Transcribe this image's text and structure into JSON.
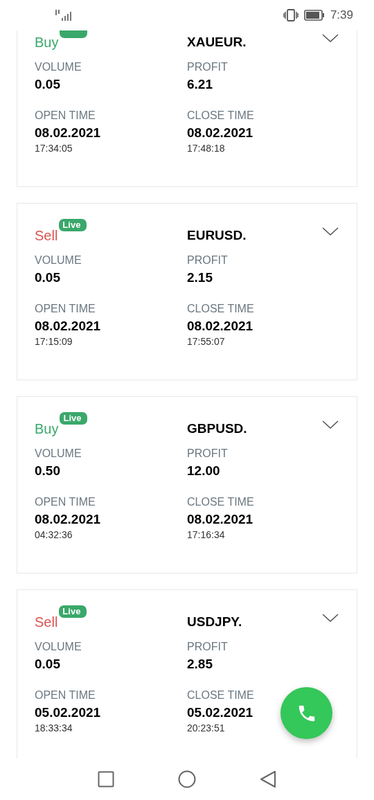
{
  "status_bar": {
    "time": "7:39"
  },
  "trades": [
    {
      "side": "Buy",
      "kind": "buy",
      "live": true,
      "symbol": "XAUEUR.",
      "volume_label": "VOLUME",
      "volume": "0.05",
      "profit_label": "PROFIT",
      "profit": "6.21",
      "open_label": "OPEN TIME",
      "open_date": "08.02.2021",
      "open_time": "17:34:05",
      "close_label": "CLOSE TIME",
      "close_date": "08.02.2021",
      "close_time": "17:48:18"
    },
    {
      "side": "Sell",
      "kind": "sell",
      "live": true,
      "badge": "Live",
      "symbol": "EURUSD.",
      "volume_label": "VOLUME",
      "volume": "0.05",
      "profit_label": "PROFIT",
      "profit": "2.15",
      "open_label": "OPEN TIME",
      "open_date": "08.02.2021",
      "open_time": "17:15:09",
      "close_label": "CLOSE TIME",
      "close_date": "08.02.2021",
      "close_time": "17:55:07"
    },
    {
      "side": "Buy",
      "kind": "buy",
      "live": true,
      "badge": "Live",
      "symbol": "GBPUSD.",
      "volume_label": "VOLUME",
      "volume": "0.50",
      "profit_label": "PROFIT",
      "profit": "12.00",
      "open_label": "OPEN TIME",
      "open_date": "08.02.2021",
      "open_time": "04:32:36",
      "close_label": "CLOSE TIME",
      "close_date": "08.02.2021",
      "close_time": "17:16:34"
    },
    {
      "side": "Sell",
      "kind": "sell",
      "live": true,
      "badge": "Live",
      "symbol": "USDJPY.",
      "volume_label": "VOLUME",
      "volume": "0.05",
      "profit_label": "PROFIT",
      "profit": "2.85",
      "open_label": "OPEN TIME",
      "open_date": "05.02.2021",
      "open_time": "18:33:34",
      "close_label": "CLOSE TIME",
      "close_date": "05.02.2021",
      "close_time": "20:23:51"
    }
  ]
}
